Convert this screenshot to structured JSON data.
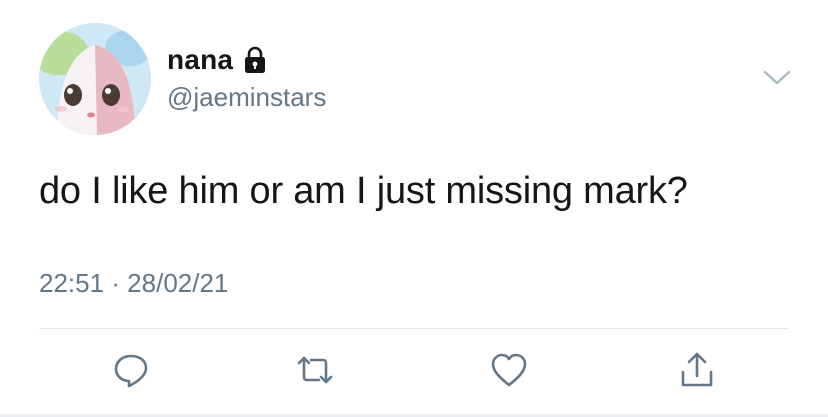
{
  "user": {
    "display_name": "nana",
    "handle": "@jaeminstars",
    "avatar_icon": "cartoon-avatar",
    "protected_icon": "lock-icon"
  },
  "tweet": {
    "text": "do I like him or am I just missing mark?",
    "timestamp": "22:51 · 28/02/21"
  },
  "menu": {
    "icon": "chevron-down-icon"
  },
  "actions": [
    {
      "name": "reply",
      "icon": "reply-icon"
    },
    {
      "name": "retweet",
      "icon": "retweet-icon"
    },
    {
      "name": "like",
      "icon": "heart-icon"
    },
    {
      "name": "share",
      "icon": "share-icon"
    }
  ],
  "colors": {
    "text_primary": "#14171a",
    "text_secondary": "#657786",
    "icon": "#657786",
    "divider": "#e1e8ed"
  }
}
